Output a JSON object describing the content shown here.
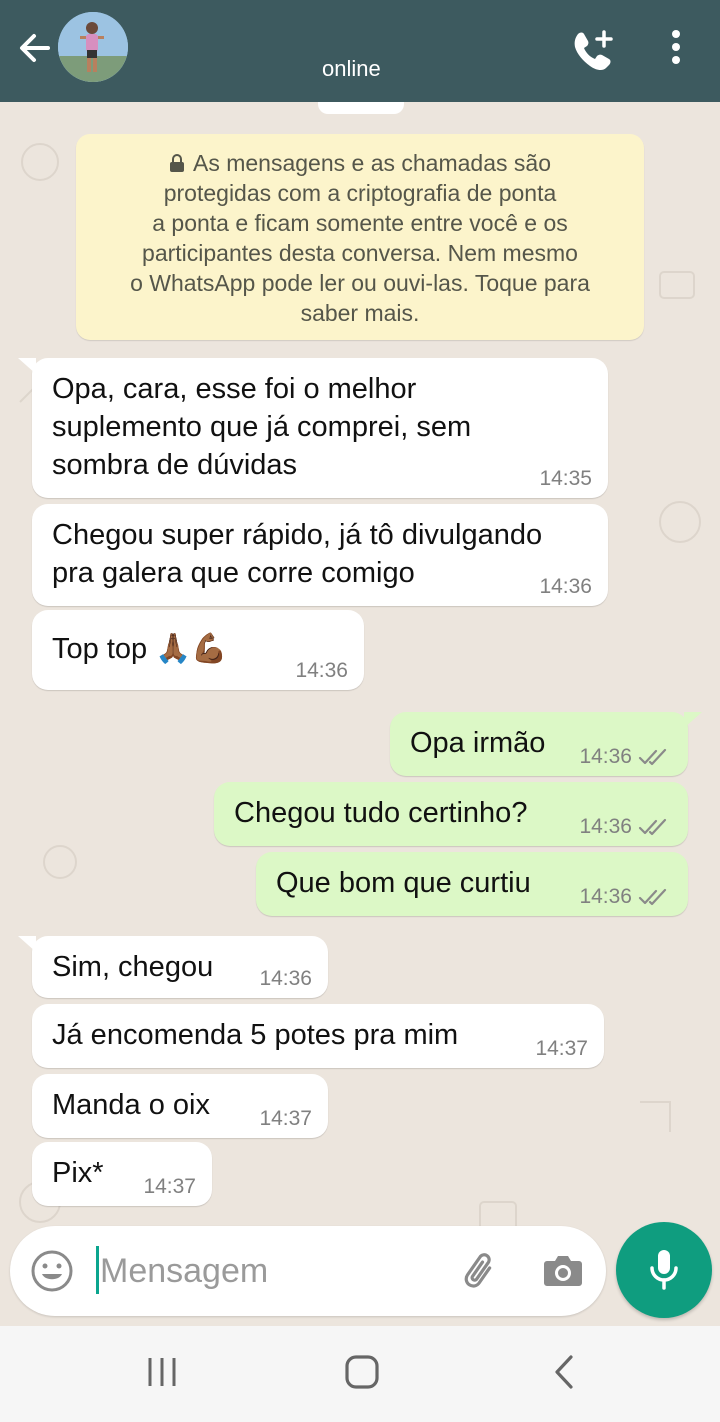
{
  "header": {
    "status": "online",
    "back_icon": "arrow-left-icon",
    "call_icon": "add-call-icon",
    "menu_icon": "more-vert-icon"
  },
  "encryption_notice": {
    "line1": "As mensagens e as chamadas são",
    "line2": "protegidas com a criptografia de ponta",
    "line3": "a ponta e ficam somente entre você e os",
    "line4": "participantes desta conversa. Nem mesmo",
    "line5": "o WhatsApp pode ler ou ouvi-las. Toque para",
    "line6": "saber mais."
  },
  "messages": [
    {
      "direction": "in",
      "text": "Opa, cara, esse foi o melhor suplemento que já comprei, sem sombra de dúvidas",
      "time": "14:35"
    },
    {
      "direction": "in",
      "text": "Chegou super rápido, já tô divulgando pra galera que corre comigo",
      "time": "14:36"
    },
    {
      "direction": "in",
      "text": "Top top 🙏🏾💪🏾",
      "time": "14:36"
    },
    {
      "direction": "out",
      "text": "Opa irmão",
      "time": "14:36"
    },
    {
      "direction": "out",
      "text": "Chegou tudo certinho?",
      "time": "14:36"
    },
    {
      "direction": "out",
      "text": "Que bom que curtiu",
      "time": "14:36"
    },
    {
      "direction": "in",
      "text": "Sim, chegou",
      "time": "14:36"
    },
    {
      "direction": "in",
      "text": "Já encomenda 5 potes pra mim",
      "time": "14:37"
    },
    {
      "direction": "in",
      "text": "Manda o oix",
      "time": "14:37"
    },
    {
      "direction": "in",
      "text": "Pix*",
      "time": "14:37"
    }
  ],
  "composer": {
    "placeholder": "Mensagem",
    "emoji_icon": "emoji-icon",
    "attach_icon": "paperclip-icon",
    "camera_icon": "camera-icon",
    "mic_icon": "mic-icon"
  },
  "colors": {
    "header": "#3d5a5f",
    "incoming": "#ffffff",
    "outgoing": "#dcf8c6",
    "notice": "#fcf4cb",
    "accent": "#0f9d7f"
  }
}
